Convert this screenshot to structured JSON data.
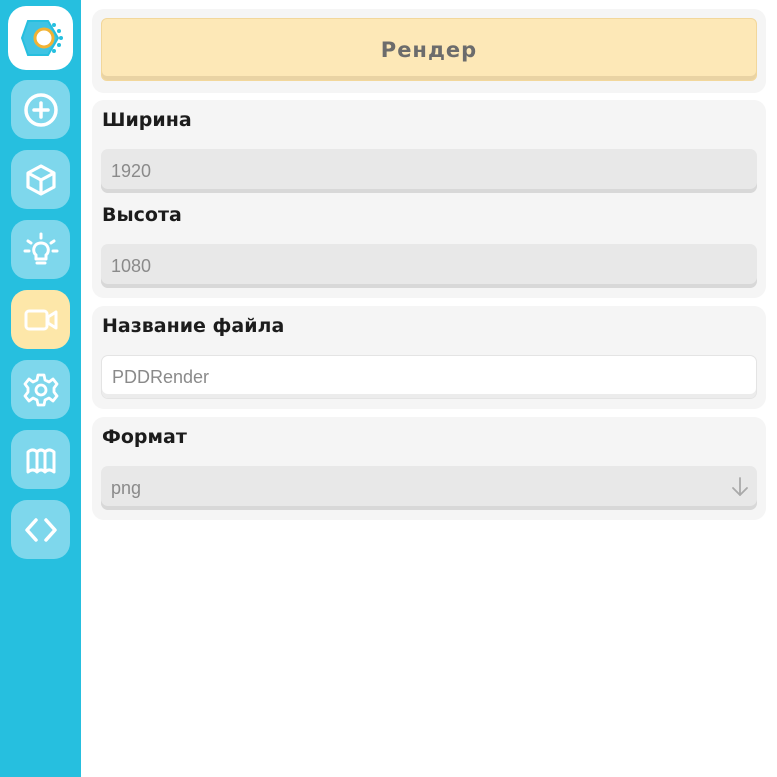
{
  "sidebar": {
    "logo_icon": "app-logo-icon",
    "items": [
      {
        "name": "add",
        "icon": "plus-circle-icon",
        "active": false
      },
      {
        "name": "objects",
        "icon": "cube-icon",
        "active": false
      },
      {
        "name": "lights",
        "icon": "lightbulb-icon",
        "active": false
      },
      {
        "name": "camera",
        "icon": "video-camera-icon",
        "active": true
      },
      {
        "name": "settings",
        "icon": "gear-icon",
        "active": false
      },
      {
        "name": "map",
        "icon": "map-icon",
        "active": false
      },
      {
        "name": "code",
        "icon": "code-icon",
        "active": false
      }
    ],
    "colors": {
      "background": "#26bfdf",
      "button": "#7ed7ec",
      "active": "#fde7a9"
    }
  },
  "render": {
    "label": "Рендер",
    "color": "#fde8b7"
  },
  "resolution": {
    "width_label": "Ширина",
    "width_value": "1920",
    "height_label": "Высота",
    "height_value": "1080"
  },
  "file": {
    "label": "Название файла",
    "value": "PDDRender"
  },
  "format": {
    "label": "Формат",
    "selected": "png",
    "icon": "arrow-down-icon"
  }
}
